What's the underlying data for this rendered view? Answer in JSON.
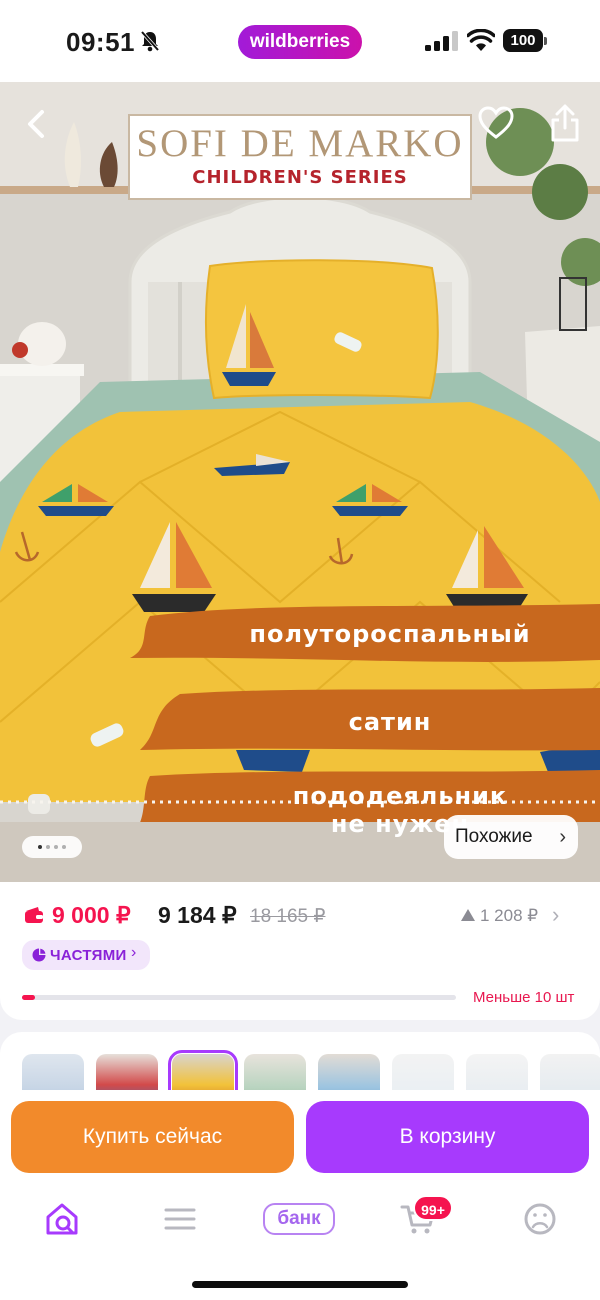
{
  "status_bar": {
    "time": "09:51",
    "app_badge": "wildberries",
    "battery": "100"
  },
  "product": {
    "brand": "SOFI DE MARKO",
    "series": "CHILDREN'S SERIES",
    "tags": [
      "полутороспальный",
      "сатин",
      "пододеяльник\nне нужен"
    ],
    "similar_label": "Похожие",
    "gallery": {
      "count": 4,
      "active_index": 0
    }
  },
  "pricing": {
    "wallet_price": "9 000 ₽",
    "price": "9 184 ₽",
    "old_price": "18 165 ₽",
    "price_increase": "1 208 ₽",
    "installments_label": "ЧАСТЯМИ",
    "stock_text": "Меньше 10 шт",
    "stock_level": 0.03
  },
  "thumbnails": {
    "count": 8,
    "selected_index": 2
  },
  "actions": {
    "buy_now": "Купить сейчас",
    "add_to_cart": "В корзину"
  },
  "tab_bar": {
    "bank_label": "банк",
    "cart_badge": "99+"
  },
  "colors": {
    "brand_purple": "#a73afd",
    "buy_orange": "#f28a2b",
    "accent_red": "#f5144f",
    "duvet_yellow": "#f2c23a",
    "tag_orange": "#c8681e"
  },
  "icons": [
    "bell-slash-icon",
    "signal-icon",
    "wifi-icon",
    "back-chevron-icon",
    "heart-icon",
    "share-icon",
    "wallet-icon",
    "triangle-up-icon",
    "installments-icon",
    "home-search-icon",
    "menu-icon",
    "cart-icon",
    "profile-icon"
  ]
}
